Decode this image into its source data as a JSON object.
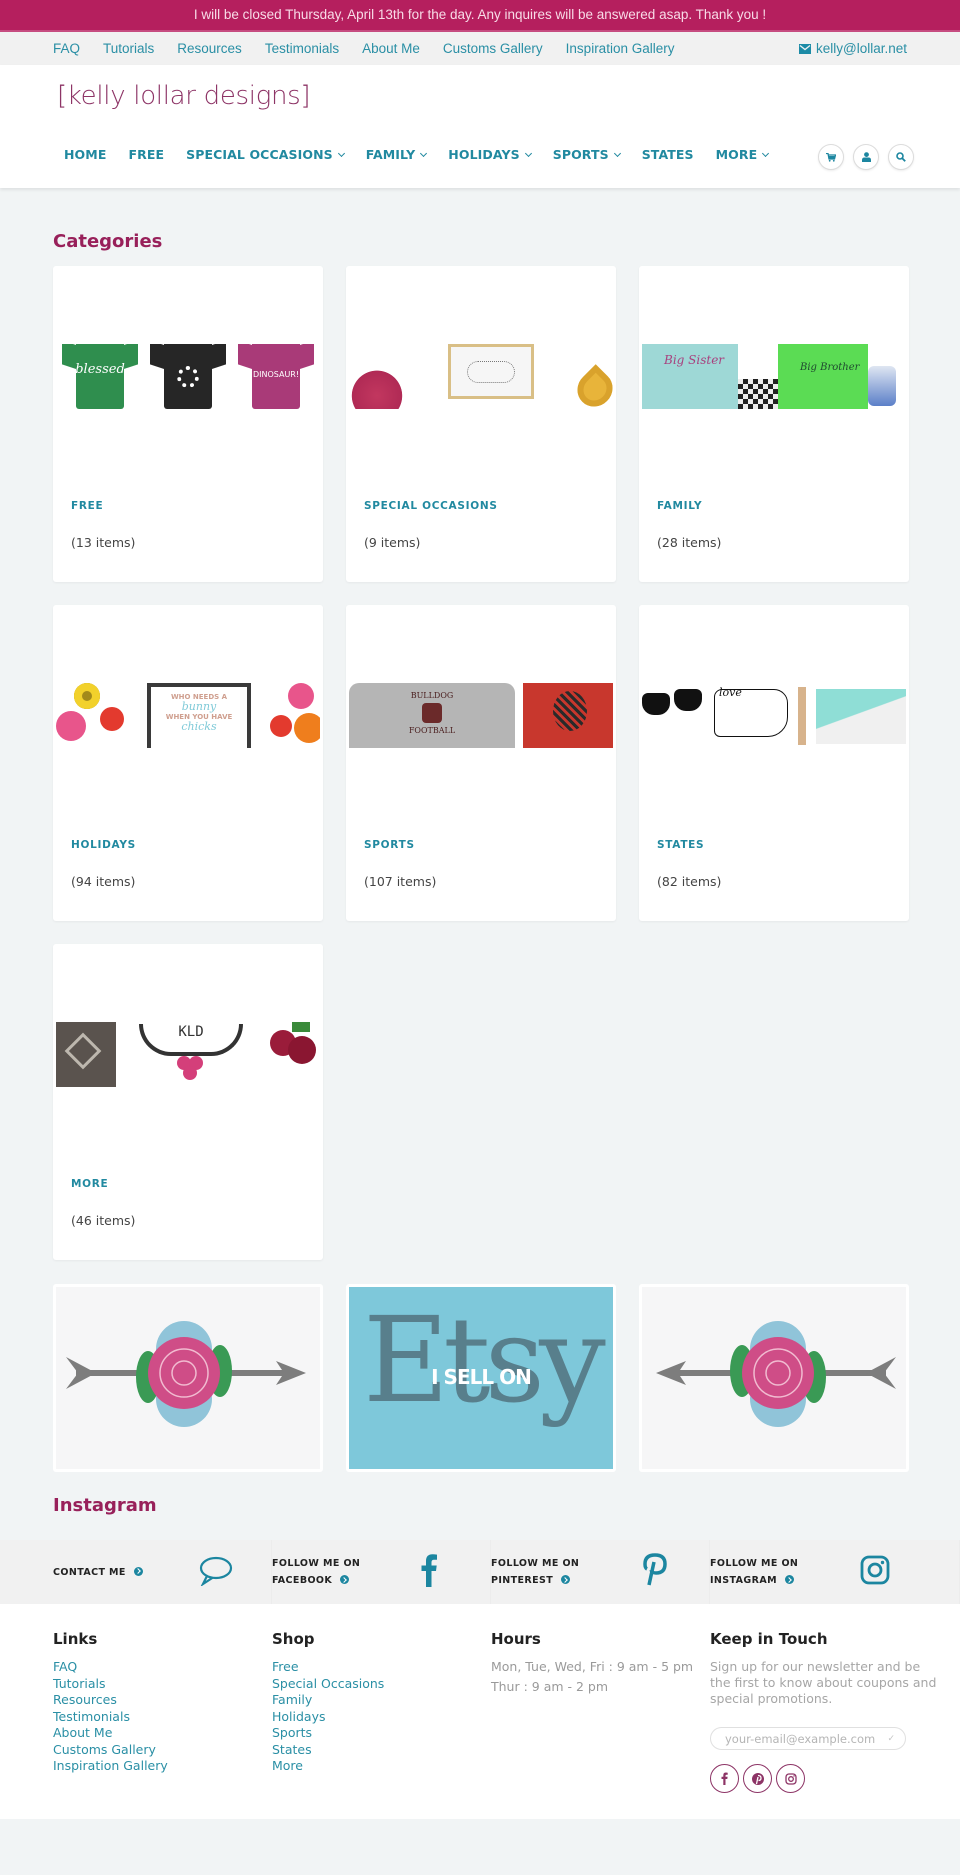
{
  "announcement": "I will be closed Thursday, April 13th for the day. Any inquires will be answered asap.  Thank you !",
  "topbar": {
    "links": [
      "FAQ",
      "Tutorials",
      "Resources",
      "Testimonials",
      "About Me",
      "Customs Gallery",
      "Inspiration Gallery"
    ],
    "email": "kelly@lollar.net",
    "email_icon": "envelope-icon"
  },
  "header": {
    "logo": "[kelly lollar designs]",
    "nav": [
      {
        "label": "HOME",
        "dropdown": false
      },
      {
        "label": "FREE",
        "dropdown": false
      },
      {
        "label": "SPECIAL OCCASIONS",
        "dropdown": true
      },
      {
        "label": "FAMILY",
        "dropdown": true
      },
      {
        "label": "HOLIDAYS",
        "dropdown": true
      },
      {
        "label": "SPORTS",
        "dropdown": true
      },
      {
        "label": "STATES",
        "dropdown": false
      },
      {
        "label": "MORE",
        "dropdown": true
      }
    ],
    "icons": [
      "cart-icon",
      "user-icon",
      "search-icon"
    ]
  },
  "categories": {
    "title": "Categories",
    "items": [
      {
        "name": "FREE",
        "count": "(13 items)",
        "image_text": [
          "blessed",
          "",
          "DINOSAUR!"
        ]
      },
      {
        "name": "SPECIAL OCCASIONS",
        "count": "(9 items)"
      },
      {
        "name": "FAMILY",
        "count": "(28 items)",
        "image_text": [
          "Big Sister",
          "Big Brother"
        ]
      },
      {
        "name": "HOLIDAYS",
        "count": "(94 items)",
        "image_text": [
          "WHO NEEDS A",
          "bunny",
          "WHEN YOU HAVE",
          "chicks"
        ]
      },
      {
        "name": "SPORTS",
        "count": "(107 items)",
        "image_text": [
          "BULLDOG",
          "FOOTBALL"
        ]
      },
      {
        "name": "STATES",
        "count": "(82 items)",
        "image_text": [
          "love"
        ]
      },
      {
        "name": "MORE",
        "count": "(46 items)",
        "image_text": [
          "KLD"
        ]
      }
    ]
  },
  "banners": {
    "etsy_word": "Etsy",
    "etsy_tagline": "I SELL ON"
  },
  "instagram": {
    "title": "Instagram"
  },
  "social_strip": [
    {
      "line1": "CONTACT ME",
      "line2": "",
      "icon": "speech-bubble-icon"
    },
    {
      "line1": "FOLLOW ME ON",
      "line2": "FACEBOOK",
      "icon": "facebook-icon"
    },
    {
      "line1": "FOLLOW ME ON",
      "line2": "PINTEREST",
      "icon": "pinterest-icon"
    },
    {
      "line1": "FOLLOW ME ON",
      "line2": "INSTAGRAM",
      "icon": "instagram-icon"
    }
  ],
  "footer": {
    "links": {
      "title": "Links",
      "items": [
        "FAQ",
        "Tutorials",
        "Resources",
        "Testimonials",
        "About Me",
        "Customs Gallery",
        "Inspiration Gallery"
      ]
    },
    "shop": {
      "title": "Shop",
      "items": [
        "Free",
        "Special Occasions",
        "Family",
        "Holidays",
        "Sports",
        "States",
        "More"
      ]
    },
    "hours": {
      "title": "Hours",
      "lines": [
        "Mon, Tue, Wed, Fri : 9 am - 5 pm",
        "Thur : 9 am - 2 pm"
      ]
    },
    "keep_in_touch": {
      "title": "Keep in Touch",
      "text": "Sign up for our newsletter and be the first to know about coupons and special promotions.",
      "email_placeholder": "your-email@example.com",
      "social_icons": [
        {
          "icon": "facebook-icon",
          "glyph": "f"
        },
        {
          "icon": "pinterest-icon",
          "glyph": "p"
        },
        {
          "icon": "instagram-icon",
          "glyph": "◎"
        }
      ]
    }
  },
  "colors": {
    "brand": "#b51f5e",
    "accent": "#2189a0",
    "heading": "#98205a"
  }
}
